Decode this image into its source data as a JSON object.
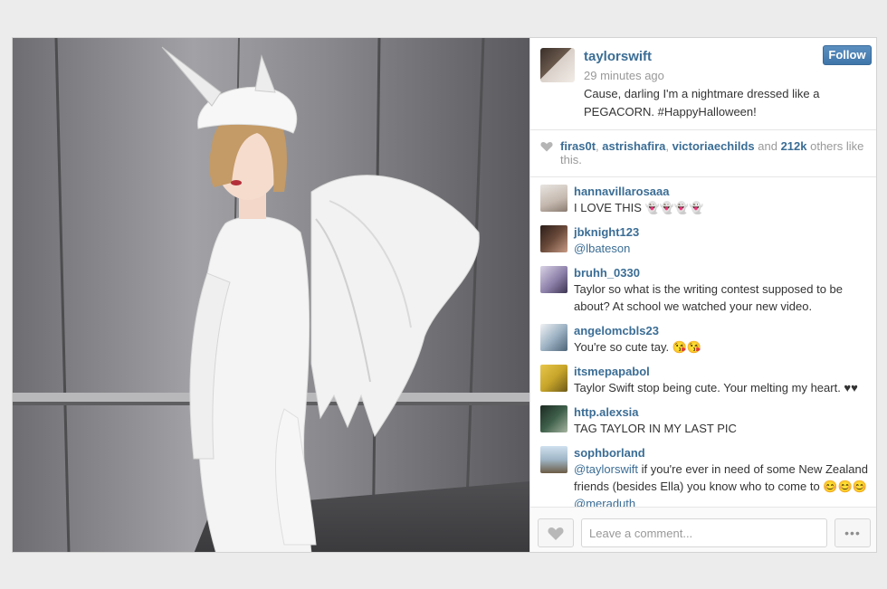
{
  "post": {
    "username": "taylorswift",
    "time_ago": "29 minutes ago",
    "caption": "Cause, darling I'm a nightmare dressed like a PEGACORN. #HappyHalloween!",
    "follow_label": "Follow"
  },
  "likes": {
    "users": [
      "firas0t",
      "astrishafira",
      "victoriaechilds"
    ],
    "sep1": ", ",
    "sep2": ", ",
    "and_text": " and ",
    "count": "212k",
    "suffix": " others like this."
  },
  "comments": [
    {
      "user": "hannavillarosaaa",
      "text": "I LOVE THIS 👻👻👻👻"
    },
    {
      "user": "jbknight123",
      "mention": "@lbateson",
      "text": ""
    },
    {
      "user": "bruhh_0330",
      "text": "Taylor so what is the writing contest supposed to be about? At school we watched your new video."
    },
    {
      "user": "angelomcbls23",
      "text": "You're so cute tay. 😘😘"
    },
    {
      "user": "itsmepapabol",
      "text": "Taylor Swift stop being cute. Your melting my heart. ♥♥"
    },
    {
      "user": "http.alexsia",
      "text": "TAG TAYLOR IN MY LAST PIC"
    },
    {
      "user": "sophborland",
      "mention": "@taylorswift",
      "text": " if you're ever in need of some New Zealand friends (besides Ella) you know who to come to 😊😊😊",
      "mention2": "@meraduth"
    }
  ],
  "footer": {
    "comment_placeholder": "Leave a comment...",
    "more_label": "•••"
  },
  "colors": {
    "link": "#3b6d95",
    "follow_bg": "#4a80b4"
  },
  "icons": {
    "like": "heart-icon",
    "more": "ellipsis-icon"
  }
}
